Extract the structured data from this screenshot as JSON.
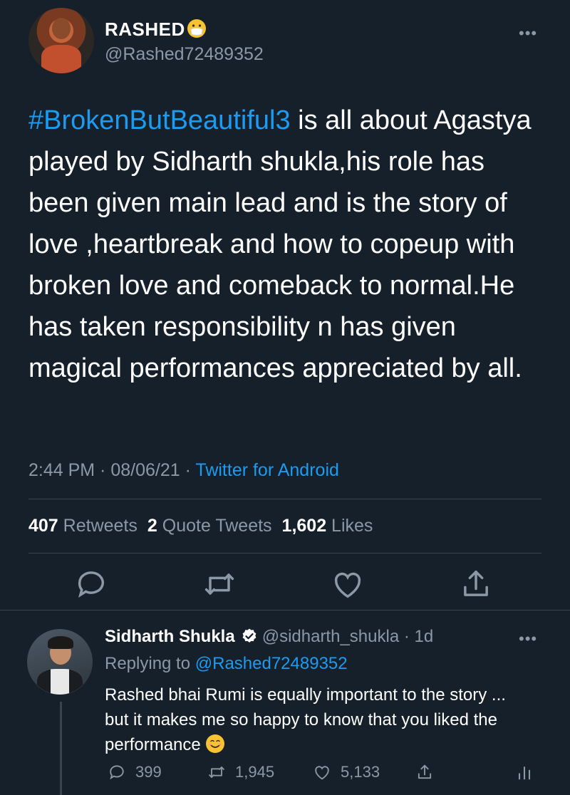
{
  "tweet": {
    "author_name": "RASHED",
    "author_emoji_icon": "mask-face-emoji",
    "author_handle": "@Rashed72489352",
    "hashtag": "#BrokenButBeautiful3",
    "text_after_hashtag": " is all about Agastya  played by Sidharth shukla,his role has been given main lead and is the story of love ,heartbreak and how to copeup with broken love and comeback to normal.He has taken responsibility n has given magical performances appreciated by all.",
    "time": "2:44 PM",
    "sep1": " · ",
    "date": "08/06/21",
    "sep2": " · ",
    "source": "Twitter for Android",
    "more": "•••"
  },
  "stats": {
    "retweets_count": "407",
    "retweets_label": " Retweets",
    "quotes_count": "2",
    "quotes_label": " Quote Tweets",
    "likes_count": "1,602",
    "likes_label": " Likes"
  },
  "actions": [
    "reply-icon",
    "retweet-icon",
    "like-icon",
    "share-icon"
  ],
  "reply": {
    "name": "Sidharth Shukla",
    "handle": "@sidharth_shukla",
    "dot": " · ",
    "age": "1d",
    "replying_prefix": "Replying to ",
    "replying_to": "@Rashed72489352",
    "text": "Rashed bhai Rumi is equally important to the story ... but it makes me so happy to know that you liked the performance",
    "emoji_icon": "smiling-face-emoji",
    "more": "•••",
    "replies": "399",
    "retweets": "1,945",
    "likes": "5,133"
  },
  "colors": {
    "background": "#15202b",
    "accent": "#1d9bf0",
    "muted": "#8b98a5",
    "divider": "#38444d"
  }
}
